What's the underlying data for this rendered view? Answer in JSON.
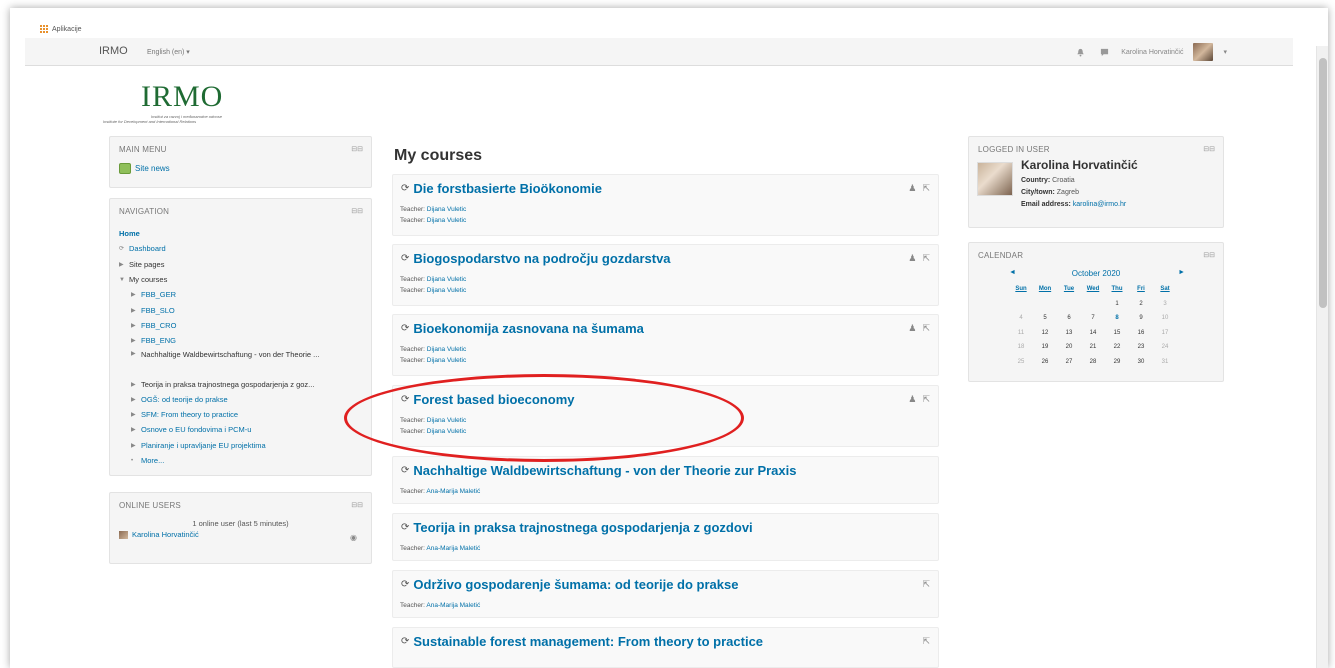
{
  "browser": {
    "apps_label": "Aplikacije"
  },
  "navbar": {
    "brand": "IRMO",
    "language": "English (en) ▾",
    "user_name": "Karolina Horvatinčić",
    "dropdown_caret": "▾"
  },
  "logo": {
    "title": "IRMO",
    "subtitle_hr": "Institut za razvoj i međunarodne odnose",
    "subtitle_en": "Institute for Development and International Relations"
  },
  "main_menu": {
    "title": "MAIN MENU",
    "items": [
      {
        "label": "Site news"
      }
    ]
  },
  "navigation": {
    "title": "NAVIGATION",
    "home": "Home",
    "dashboard": "Dashboard",
    "site_pages": "Site pages",
    "my_courses": "My courses",
    "courses": [
      "FBB_GER",
      "FBB_SLO",
      "FBB_CRO",
      "FBB_ENG",
      "Nachhaltige Waldbewirtschaftung - von der Theorie ...",
      "Teorija in praksa trajnostnega gospodarjenja z goz...",
      "OGŠ: od teorije do prakse",
      "SFM: From theory to practice",
      "Osnove o EU fondovima i PCM-u",
      "Planiranje i upravljanje EU projektima"
    ],
    "more": "More..."
  },
  "online_users": {
    "title": "ONLINE USERS",
    "summary": "1 online user (last 5 minutes)",
    "user": "Karolina Horvatinčić"
  },
  "my_courses": {
    "title": "My courses",
    "courses": [
      {
        "name": "Die forstbasierte Bioökonomie",
        "teachers": [
          "Dijana Vuletic",
          "Dijana Vuletic"
        ]
      },
      {
        "name": "Biogospodarstvo na področju gozdarstva",
        "teachers": [
          "Dijana Vuletic",
          "Dijana Vuletic"
        ]
      },
      {
        "name": "Bioekonomija zasnovana na šumama",
        "teachers": [
          "Dijana Vuletic",
          "Dijana Vuletic"
        ]
      },
      {
        "name": "Forest based bioeconomy",
        "teachers": [
          "Dijana Vuletic",
          "Dijana Vuletic"
        ]
      },
      {
        "name": "Nachhaltige Waldbewirtschaftung - von der Theorie zur Praxis",
        "teachers": [
          "Ana-Marija Maletić"
        ]
      },
      {
        "name": "Teorija in praksa trajnostnega gospodarjenja z gozdovi",
        "teachers": [
          "Ana-Marija Maletić"
        ]
      },
      {
        "name": "Održivo gospodarenje šumama: od teorije do prakse",
        "teachers": [
          "Ana-Marija Maletić"
        ]
      },
      {
        "name": "Sustainable forest management: From theory to practice",
        "teachers": []
      }
    ],
    "teacher_label": "Teacher: "
  },
  "logged_in_user": {
    "title": "LOGGED IN USER",
    "name": "Karolina Horvatinčić",
    "country_label": "Country:",
    "country": "Croatia",
    "city_label": "City/town:",
    "city": "Zagreb",
    "email_label": "Email address:",
    "email": "karolina@irmo.hr"
  },
  "calendar": {
    "title": "CALENDAR",
    "month": "October 2020",
    "prev": "◄",
    "next": "►",
    "weekdays": [
      "Sun",
      "Mon",
      "Tue",
      "Wed",
      "Thu",
      "Fri",
      "Sat"
    ],
    "days": [
      "",
      "",
      "",
      "",
      "1",
      "2",
      "3",
      "4",
      "5",
      "6",
      "7",
      "8",
      "9",
      "10",
      "11",
      "12",
      "13",
      "14",
      "15",
      "16",
      "17",
      "18",
      "19",
      "20",
      "21",
      "22",
      "23",
      "24",
      "25",
      "26",
      "27",
      "28",
      "29",
      "30",
      "31"
    ],
    "today": "8"
  },
  "colors": {
    "link": "#0070a8",
    "highlight": "#e02020",
    "logo": "#1f6b33"
  }
}
